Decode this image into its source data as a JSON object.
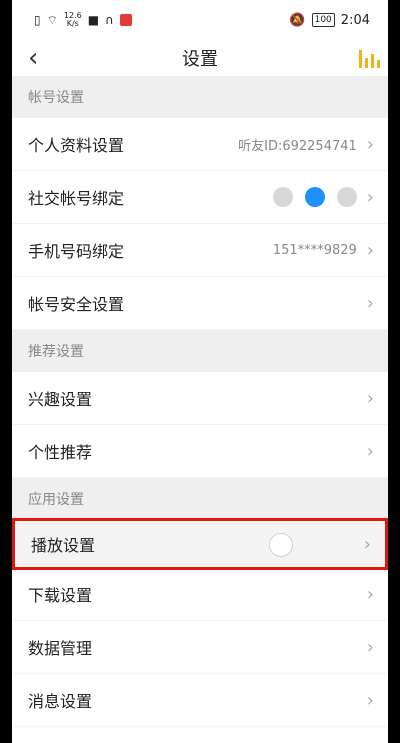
{
  "status_bar": {
    "net_speed_top": "12.6",
    "net_speed_bottom": "K/s",
    "battery": "100",
    "time": "2:04"
  },
  "header": {
    "back_icon": "back-chevron",
    "title": "设置",
    "right_icon": "bars-icon"
  },
  "sections": [
    {
      "title": "帐号设置",
      "items": [
        {
          "label": "个人资料设置",
          "value": "听友ID:692254741"
        },
        {
          "label": "社交帐号绑定",
          "value": ""
        },
        {
          "label": "手机号码绑定",
          "value": "151****9829"
        },
        {
          "label": "帐号安全设置",
          "value": ""
        }
      ]
    },
    {
      "title": "推荐设置",
      "items": [
        {
          "label": "兴趣设置",
          "value": ""
        },
        {
          "label": "个性推荐",
          "value": ""
        }
      ]
    },
    {
      "title": "应用设置",
      "items": [
        {
          "label": "播放设置",
          "value": ""
        },
        {
          "label": "下载设置",
          "value": ""
        },
        {
          "label": "数据管理",
          "value": ""
        },
        {
          "label": "消息设置",
          "value": ""
        }
      ]
    }
  ],
  "colors": {
    "accent": "#f2b21c",
    "highlight_border": "#e01616",
    "social_active": "#1e90ff"
  }
}
